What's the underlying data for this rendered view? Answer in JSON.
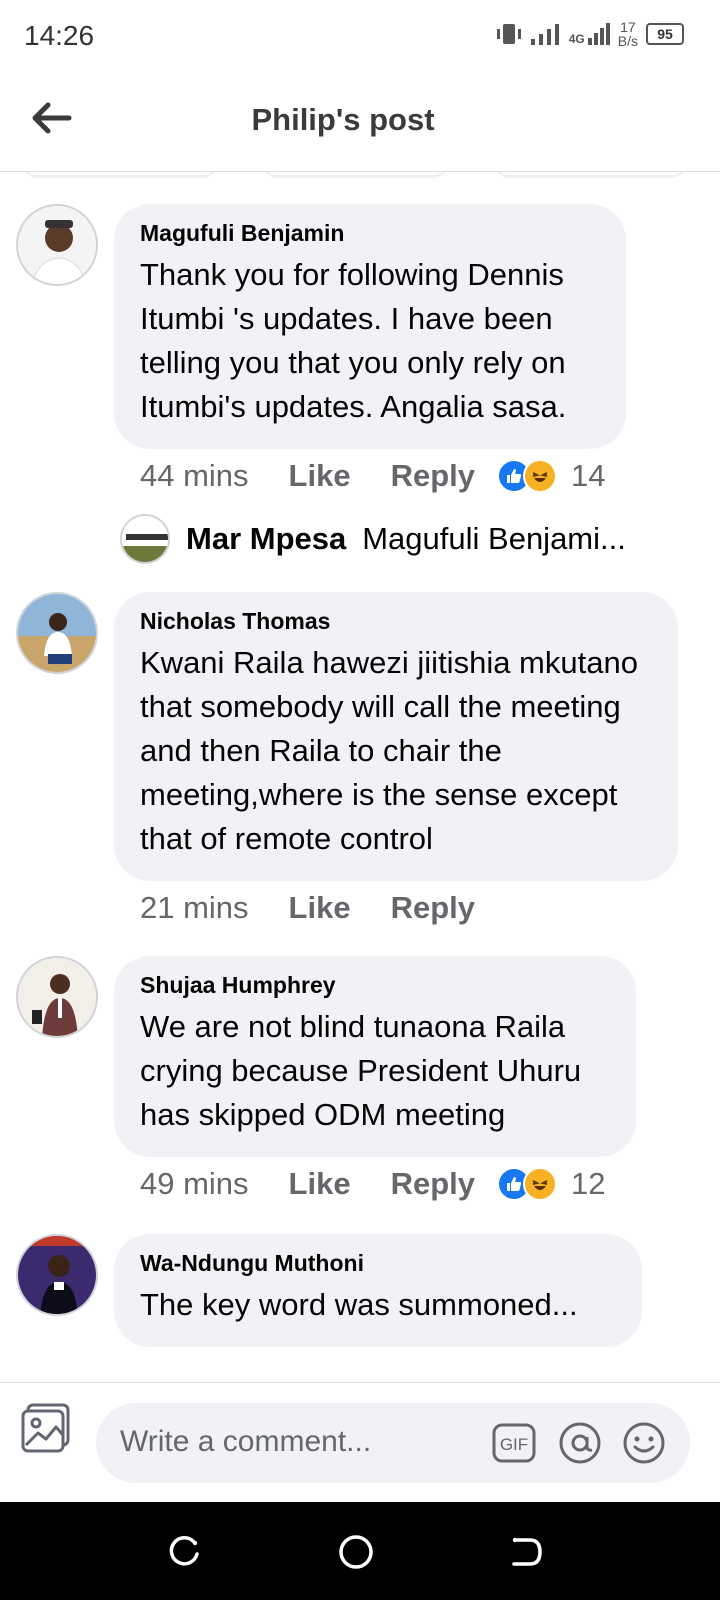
{
  "status_bar": {
    "time": "14:26",
    "network": "4G",
    "speed_value": "17",
    "speed_unit": "B/s",
    "battery": "95"
  },
  "header": {
    "title": "Philip's post",
    "back_icon": "arrow-left-icon"
  },
  "comments": [
    {
      "author": "Magufuli Benjamin",
      "text": "Thank you for following Dennis Itumbi 's updates. I have been telling you that you only rely on Itumbi's updates. Angalia sasa.",
      "time": "44 mins",
      "like_label": "Like",
      "reply_label": "Reply",
      "reactions": [
        "like",
        "haha"
      ],
      "reaction_count": "14"
    },
    {
      "author": "Nicholas Thomas",
      "text": "Kwani Raila hawezi jiitishia mkutano that somebody will call the meeting and then Raila to chair the meeting,where is the sense except that of remote control",
      "time": "21 mins",
      "like_label": "Like",
      "reply_label": "Reply"
    },
    {
      "author": "Shujaa Humphrey",
      "text": "We are not blind tunaona Raila crying because President Uhuru has skipped ODM meeting",
      "time": "49 mins",
      "like_label": "Like",
      "reply_label": "Reply",
      "reactions": [
        "like",
        "haha"
      ],
      "reaction_count": "12"
    },
    {
      "author": "Wa-Ndungu Muthoni",
      "text": "The  key word was summoned..."
    }
  ],
  "reply_preview": {
    "author": "Mar Mpesa",
    "text": "Magufuli Benjami..."
  },
  "composer": {
    "placeholder": "Write a comment...",
    "gif_label": "GIF"
  },
  "colors": {
    "bubble": "#f0f2f5",
    "meta": "#65676b",
    "like_blue": "#1877f2",
    "haha_yellow": "#f7b125"
  }
}
